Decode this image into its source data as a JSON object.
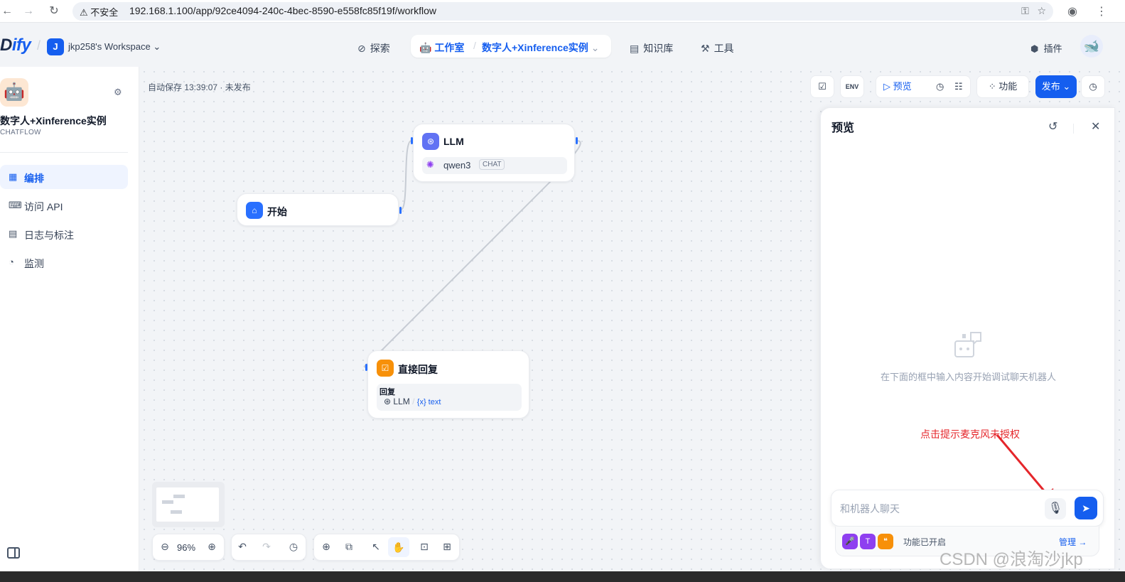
{
  "browser": {
    "security_label": "不安全",
    "url": "192.168.1.100/app/92ce4094-240c-4bec-8590-e558fc85f19f/workflow"
  },
  "header": {
    "logo_first": "D",
    "logo_rest": "ify",
    "workspace_initial": "J",
    "workspace_name": "jkp258's Workspace",
    "nav": {
      "explore": "探索",
      "studio": "工作室",
      "app": "数字人+Xinference实例",
      "knowledge": "知识库",
      "tools": "工具",
      "plugins": "插件"
    }
  },
  "sidebar": {
    "app_name": "数字人+Xinference实例",
    "app_mode": "CHATFLOW",
    "items": [
      {
        "label": "编排",
        "icon": "layout-icon",
        "active": true
      },
      {
        "label": "访问 API",
        "icon": "terminal-icon",
        "active": false
      },
      {
        "label": "日志与标注",
        "icon": "document-icon",
        "active": false
      },
      {
        "label": "监测",
        "icon": "gauge-icon",
        "active": false
      }
    ]
  },
  "canvas": {
    "autosave": "自动保存 13:39:07 · 未发布",
    "toolbar": {
      "preview": "预览",
      "features": "功能",
      "publish": "发布"
    },
    "nodes": {
      "start": {
        "title": "开始"
      },
      "llm": {
        "title": "LLM",
        "model": "qwen3",
        "model_tag": "CHAT"
      },
      "answer": {
        "title": "直接回复",
        "label": "回复",
        "source": "LLM",
        "variable": "{x} text"
      }
    },
    "zoom": "96%"
  },
  "preview": {
    "title": "预览",
    "empty_hint": "在下面的框中输入内容开始调试聊天机器人",
    "annotation": "点击提示麦克风未授权",
    "input_placeholder": "和机器人聊天",
    "features_enabled": "功能已开启",
    "manage": "管理"
  },
  "watermark": "CSDN @浪淘沙jkp",
  "colors": {
    "primary": "#155eef",
    "annotation_red": "#e5262b"
  }
}
